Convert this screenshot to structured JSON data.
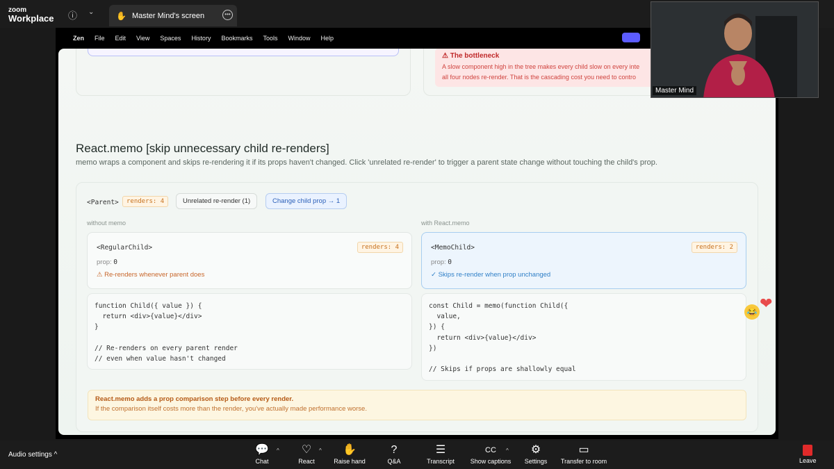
{
  "zoom": {
    "logo_line1": "zoom",
    "logo_line2": "Workplace",
    "share_tab": "Master Mind's screen",
    "participant_name": "Master Mind",
    "audio_settings": "Audio settings",
    "toolbar": [
      {
        "label": "Chat",
        "icon": "chat-icon",
        "glyph": "💬"
      },
      {
        "label": "React",
        "icon": "heart-icon",
        "glyph": "♡"
      },
      {
        "label": "Raise hand",
        "icon": "hand-icon",
        "glyph": "✋"
      },
      {
        "label": "Q&A",
        "icon": "question-icon",
        "glyph": "?"
      },
      {
        "label": "Transcript",
        "icon": "transcript-icon",
        "glyph": "☰"
      },
      {
        "label": "Show captions",
        "icon": "cc-icon",
        "glyph": "CC"
      },
      {
        "label": "Settings",
        "icon": "gear-icon",
        "glyph": "⚙"
      },
      {
        "label": "Transfer to room",
        "icon": "transfer-icon",
        "glyph": "▭"
      }
    ],
    "leave": "Leave"
  },
  "mac_menu": {
    "app": "Zen",
    "items": [
      "File",
      "Edit",
      "View",
      "Spaces",
      "History",
      "Bookmarks",
      "Tools",
      "Window",
      "Help"
    ]
  },
  "page": {
    "bottleneck_title": "⚠ The bottleneck",
    "bottleneck_line1": "A slow component high in the tree makes every child slow on every inte",
    "bottleneck_line2": "all four nodes re-render. That is the cascading cost you need to contro",
    "section_title": "React.memo [skip unnecessary child re-renders]",
    "section_sub": "memo wraps a component and skips re-rendering it if its props haven't changed. Click 'unrelated re-render' to trigger a parent state change without touching the child's prop.",
    "parent_tag": "<Parent>",
    "parent_renders": "renders: 4",
    "btn_unrelated": "Unrelated re-render (1)",
    "btn_change": "Change child prop → 1",
    "label_without": "without memo",
    "label_with": "with React.memo",
    "regular": {
      "name": "<RegularChild>",
      "renders": "renders: 4",
      "prop_label": "prop:",
      "prop_value": "0",
      "note": "⚠ Re-renders whenever parent does"
    },
    "memo": {
      "name": "<MemoChild>",
      "renders": "renders: 2",
      "prop_label": "prop:",
      "prop_value": "0",
      "note": "✓ Skips re-render when prop unchanged"
    },
    "code_regular": "function Child({ value }) {\n  return <div>{value}</div>\n}\n\n// Re-renders on every parent render\n// even when value hasn't changed",
    "code_memo": "const Child = memo(function Child({\n  value,\n}) {\n  return <div>{value}</div>\n})\n\n// Skips if props are shallowly equal",
    "warn_title": "React.memo adds a prop comparison step before every render.",
    "warn_body": "If the comparison itself costs more than the render, you've actually made performance worse."
  }
}
